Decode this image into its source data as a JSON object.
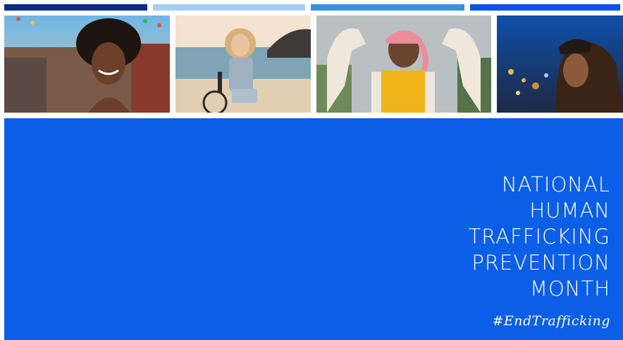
{
  "colors": {
    "bar_dark_navy": "#0b2a8a",
    "bar_light_blue": "#a9cdf2",
    "bar_mid_blue": "#3a8ee6",
    "bar_bright_blue": "#0a53e6",
    "panel_blue": "#0a5ee8",
    "text": "#ffffff"
  },
  "photos": [
    {
      "subject": "smiling woman at festival"
    },
    {
      "subject": "woman in wheelchair on beach"
    },
    {
      "subject": "woman flexing arms with pink head scarf"
    },
    {
      "subject": "man in hooded jacket at night"
    }
  ],
  "headline": {
    "lines": [
      "NATIONAL",
      "HUMAN",
      "TRAFFICKING",
      "PREVENTION",
      "MONTH"
    ]
  },
  "hashtag": "#EndTrafficking"
}
